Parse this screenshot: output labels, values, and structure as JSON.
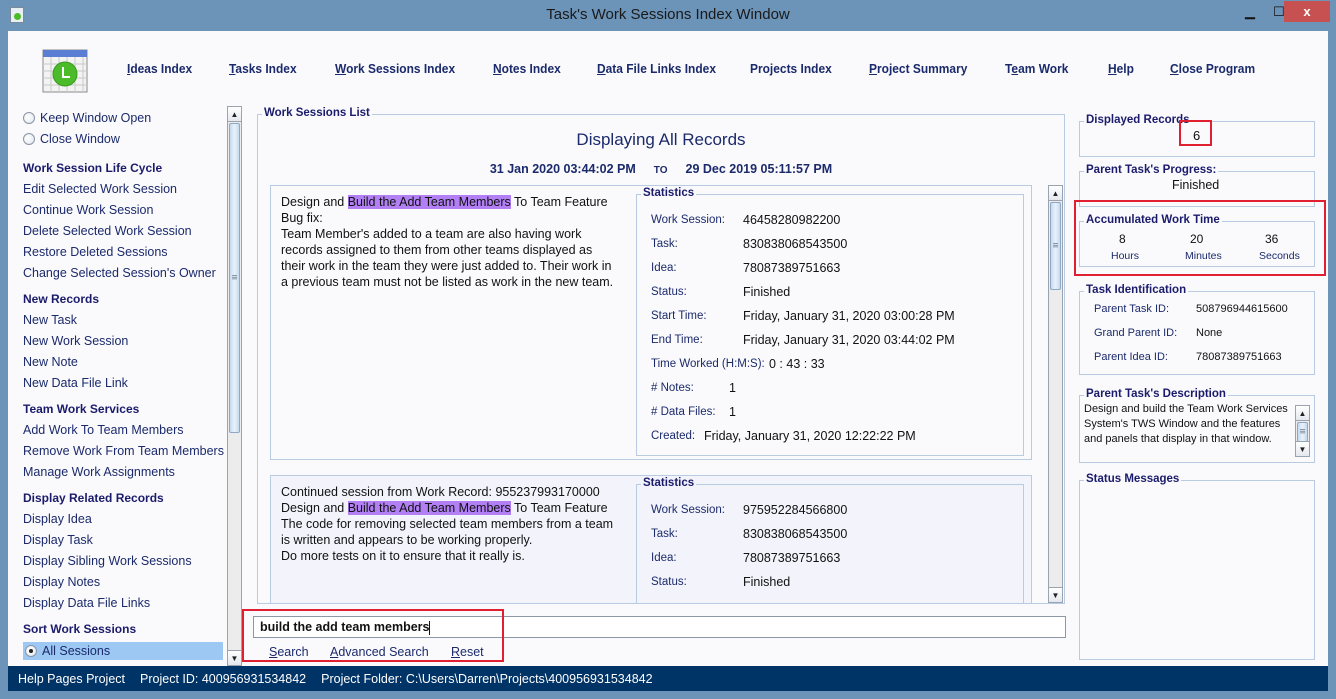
{
  "window": {
    "title": "Task's Work Sessions Index Window",
    "controls": {
      "minimize": "▁",
      "maximize": "☐",
      "close": "x"
    }
  },
  "nav": [
    {
      "label": "Ideas Index",
      "mnemonic": "I"
    },
    {
      "label": "Tasks Index",
      "mnemonic": "T"
    },
    {
      "label": "Work Sessions Index",
      "mnemonic": "W"
    },
    {
      "label": "Notes Index",
      "mnemonic": "N"
    },
    {
      "label": "Data File Links Index",
      "mnemonic": "D"
    },
    {
      "label": "Projects Index",
      "mnemonic": ""
    },
    {
      "label": "Project Summary",
      "mnemonic": "P"
    },
    {
      "label": "Team Work",
      "mnemonic": "e"
    },
    {
      "label": "Help",
      "mnemonic": "H"
    },
    {
      "label": "Close Program",
      "mnemonic": "C"
    }
  ],
  "sidebar": {
    "radios": [
      {
        "label": "Keep Window Open",
        "selected": false
      },
      {
        "label": "Close Window",
        "selected": false
      }
    ],
    "sections": [
      {
        "heading": "Work Session Life Cycle",
        "items": [
          "Edit Selected Work Session",
          "Continue Work Session",
          "Delete Selected Work Session",
          "Restore Deleted Sessions",
          "Change Selected Session's Owner"
        ]
      },
      {
        "heading": "New Records",
        "items": [
          "New Task",
          "New Work Session",
          "New Note",
          "New Data File Link"
        ]
      },
      {
        "heading": "Team Work Services",
        "items": [
          "Add Work To Team Members",
          "Remove Work From Team Members",
          "Manage Work Assignments"
        ]
      },
      {
        "heading": "Display Related Records",
        "items": [
          "Display Idea",
          "Display Task",
          "Display Sibling Work Sessions",
          "Display Notes",
          "Display Data File Links"
        ]
      },
      {
        "heading": "Sort Work Sessions",
        "items": []
      }
    ],
    "sort_option": {
      "label": "All Sessions",
      "selected": true
    }
  },
  "main": {
    "group_title": "Work Sessions List",
    "heading": "Displaying All Records",
    "date_from": "31 Jan 2020  03:44:02 PM",
    "date_to_label": "TO",
    "date_to": "29 Dec 2019  05:11:57 PM",
    "records": [
      {
        "lines": [
          {
            "pre": "Design and ",
            "hl": "Build the Add Team Members",
            "post": " To Team Feature"
          },
          {
            "pre": "Bug fix:",
            "hl": "",
            "post": ""
          },
          {
            "pre": "Team Member's added to a team are also having work",
            "hl": "",
            "post": ""
          },
          {
            "pre": "records assigned to them from other teams displayed as",
            "hl": "",
            "post": ""
          },
          {
            "pre": "their work in the team they were just added to. Their work in",
            "hl": "",
            "post": ""
          },
          {
            "pre": "a previous team must not be listed as work in the new team.",
            "hl": "",
            "post": ""
          }
        ],
        "stats_title": "Statistics",
        "stats": {
          "work_session_label": "Work Session:",
          "work_session": "46458280982200",
          "task_label": "Task:",
          "task": "830838068543500",
          "idea_label": "Idea:",
          "idea": "78087389751663",
          "status_label": "Status:",
          "status": "Finished",
          "start_label": "Start Time:",
          "start": "Friday, January 31, 2020   03:00:28 PM",
          "end_label": "End Time:",
          "end": "Friday, January 31, 2020   03:44:02 PM",
          "worked_label": "Time Worked (H:M:S):",
          "worked": "0   :  43   :  33",
          "notes_label": "# Notes:",
          "notes": "1",
          "files_label": "# Data Files:",
          "files": "1",
          "created_label": "Created:",
          "created": "Friday, January 31, 2020    12:22:22 PM"
        }
      },
      {
        "lines": [
          {
            "pre": "Continued session from Work Record: 955237993170000",
            "hl": "",
            "post": ""
          },
          {
            "pre": "Design and ",
            "hl": "Build the Add Team Members",
            "post": " To Team Feature"
          },
          {
            "pre": "The code for removing selected team members from a team",
            "hl": "",
            "post": ""
          },
          {
            "pre": "is written and appears to be working properly.",
            "hl": "",
            "post": ""
          },
          {
            "pre": "Do more tests on it to ensure that it really is.",
            "hl": "",
            "post": ""
          }
        ],
        "stats_title": "Statistics",
        "stats": {
          "work_session_label": "Work Session:",
          "work_session": "975952284566800",
          "task_label": "Task:",
          "task": "830838068543500",
          "idea_label": "Idea:",
          "idea": "78087389751663",
          "status_label": "Status:",
          "status": "Finished"
        }
      }
    ]
  },
  "search": {
    "value": "build the add team members",
    "search_label": "Search",
    "advanced_label": "Advanced Search",
    "reset_label": "Reset"
  },
  "right_panel": {
    "displayed_records_title": "Displayed Records",
    "displayed_records": "6",
    "progress_title": "Parent Task's Progress:",
    "progress": "Finished",
    "work_time_title": "Accumulated Work Time",
    "hours": "8",
    "hours_label": "Hours",
    "minutes": "20",
    "minutes_label": "Minutes",
    "seconds": "36",
    "seconds_label": "Seconds",
    "task_id_title": "Task Identification",
    "parent_task_label": "Parent Task ID:",
    "parent_task": "508796944615600",
    "grand_parent_label": "Grand Parent ID:",
    "grand_parent": "None",
    "parent_idea_label": "Parent Idea ID:",
    "parent_idea": "78087389751663",
    "description_title": "Parent Task's Description",
    "description": "Design and build the Team Work Services System's TWS Window and the features and panels that display in that window.",
    "status_messages_title": "Status Messages"
  },
  "statusbar": {
    "project": "Help Pages Project",
    "project_id": "Project ID:  400956931534842",
    "project_folder": "Project Folder: C:\\Users\\Darren\\Projects\\400956931534842"
  },
  "colors": {
    "titlebar": "#6c93b8",
    "accent_text": "#1b2a6b",
    "highlight": "#b27ff5",
    "selection": "#9cc8f3",
    "statusbar": "#003366",
    "annotation_red": "#e02030",
    "close_button": "#c75050"
  }
}
